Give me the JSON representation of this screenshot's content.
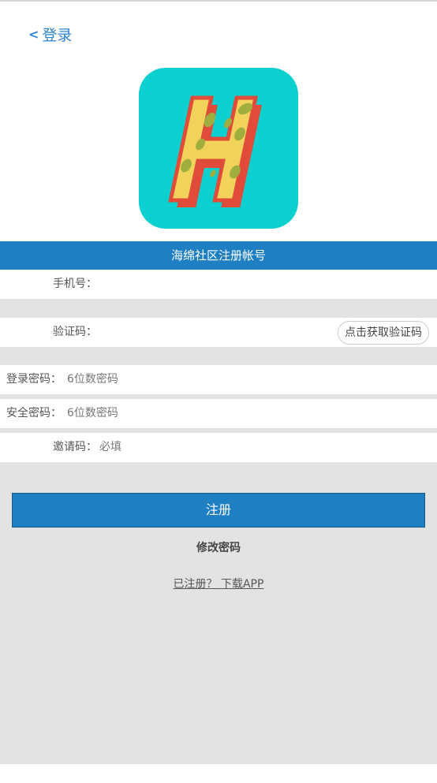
{
  "header": {
    "back_label": "登录"
  },
  "banner": {
    "title": "海绵社区注册帐号"
  },
  "form": {
    "phone": {
      "label": "手机号：",
      "placeholder": ""
    },
    "code": {
      "label": "验证码：",
      "placeholder": "",
      "button": "点击获取验证码"
    },
    "login_password": {
      "label": "登录密码：",
      "placeholder": "6位数密码"
    },
    "safe_password": {
      "label": "安全密码：",
      "placeholder": "6位数密码"
    },
    "invite": {
      "label": "邀请码：",
      "placeholder": "必填"
    }
  },
  "actions": {
    "register": "注册",
    "change_password": "修改密码",
    "download": "已注册？ 下载APP"
  },
  "colors": {
    "accent": "#1f7fc3",
    "icon_bg": "#0ccfcf",
    "letter_fill": "#f1d35b",
    "letter_shadow": "#e14b39",
    "spots": "#9fae3c"
  },
  "icons": {
    "app_logo": "h-letter-logo-icon",
    "back": "chevron-left-icon"
  }
}
